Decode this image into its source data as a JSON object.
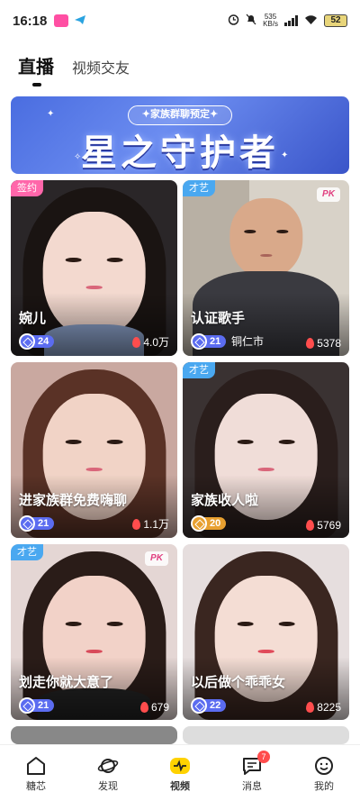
{
  "status_bar": {
    "time": "16:18",
    "net_speed": "535",
    "net_unit": "KB/s",
    "battery": "52"
  },
  "tabs": [
    {
      "label": "直播",
      "active": true
    },
    {
      "label": "视频交友",
      "active": false
    }
  ],
  "banner": {
    "subtitle": "✦家族群聊预定✦",
    "title": "星之守护者"
  },
  "cards": [
    {
      "name": "婉儿",
      "tag": "签约",
      "tag_color": "#ff66aa",
      "level": "24",
      "level_color": "#5b6cf0",
      "heat": "4.0万",
      "city": "",
      "pk": false
    },
    {
      "name": "认证歌手",
      "tag": "才艺",
      "tag_color": "#4aa8f0",
      "level": "21",
      "level_color": "#5b6cf0",
      "heat": "5378",
      "city": "铜仁市",
      "pk": true
    },
    {
      "name": "进家族群免费嗨聊",
      "tag": "",
      "tag_color": "",
      "level": "21",
      "level_color": "#5b6cf0",
      "heat": "1.1万",
      "city": "",
      "pk": false
    },
    {
      "name": "家族收人啦",
      "tag": "才艺",
      "tag_color": "#4aa8f0",
      "level": "20",
      "level_color": "#e8a030",
      "heat": "5769",
      "city": "",
      "pk": false
    },
    {
      "name": "划走你就大意了",
      "tag": "才艺",
      "tag_color": "#4aa8f0",
      "level": "21",
      "level_color": "#5b6cf0",
      "heat": "679",
      "city": "",
      "pk": true
    },
    {
      "name": "以后做个乖乖女",
      "tag": "",
      "tag_color": "",
      "level": "22",
      "level_color": "#5b6cf0",
      "heat": "8225",
      "city": "",
      "pk": false
    }
  ],
  "pk_label": "PK",
  "nav": [
    {
      "label": "糖芯",
      "icon": "home-icon",
      "active": false
    },
    {
      "label": "发现",
      "icon": "planet-icon",
      "active": false
    },
    {
      "label": "视频",
      "icon": "video-icon",
      "active": true
    },
    {
      "label": "消息",
      "icon": "message-icon",
      "active": false,
      "badge": "7"
    },
    {
      "label": "我的",
      "icon": "smile-icon",
      "active": false
    }
  ],
  "colors": {
    "accent": "#ffd200",
    "tag_blue": "#4aa8f0",
    "tag_pink": "#ff66aa",
    "heat_red": "#ff4d4d"
  }
}
